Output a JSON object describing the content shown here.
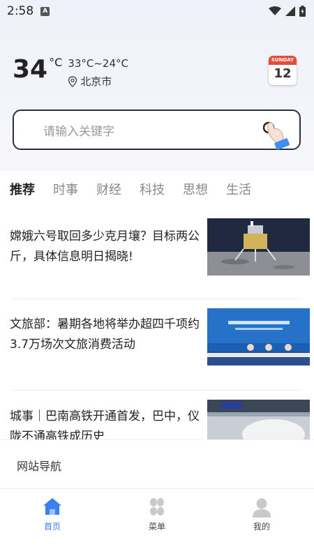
{
  "status_bar": {
    "time": "2:58",
    "a_badge": "A"
  },
  "weather": {
    "temperature": "34",
    "unit": "°C",
    "range": "33°C~24°C",
    "city": "北京市"
  },
  "calendar": {
    "day_name": "SUNDAY",
    "day_number": "12"
  },
  "search": {
    "placeholder": "请输入关键字"
  },
  "tabs": [
    {
      "label": "推荐",
      "active": true
    },
    {
      "label": "时事",
      "active": false
    },
    {
      "label": "财经",
      "active": false
    },
    {
      "label": "科技",
      "active": false
    },
    {
      "label": "思想",
      "active": false
    },
    {
      "label": "生活",
      "active": false
    }
  ],
  "news": [
    {
      "title": "嫦娥六号取回多少克月壤？目标两公斤，具体信息明日揭晓!"
    },
    {
      "title": "文旅部：暑期各地将举办超四千项约3.7万场次文旅消费活动"
    },
    {
      "title": "城事｜巴南高铁开通首发，巴中，仪陇不通高铁成历史"
    }
  ],
  "site_nav": {
    "label": "网站导航"
  },
  "bottom_nav": [
    {
      "label": "首页",
      "icon": "home-icon",
      "active": true
    },
    {
      "label": "菜单",
      "icon": "grid-icon",
      "active": false
    },
    {
      "label": "我的",
      "icon": "user-icon",
      "active": false
    }
  ],
  "colors": {
    "accent": "#3b7ff5",
    "calendar_red": "#e64a3b"
  }
}
